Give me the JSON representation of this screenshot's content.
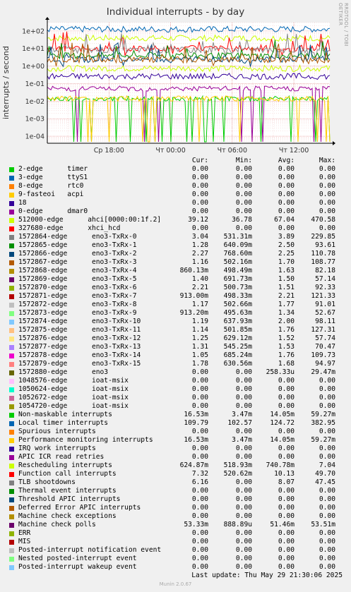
{
  "header": {
    "title": "Individual interrupts - by day",
    "side_credit": "RRDTOOL / TOBI OETIKER"
  },
  "chart_data": {
    "type": "line",
    "title": "Individual interrupts - by day",
    "ylabel": "interrupts / second",
    "yscale": "log",
    "ylim": [
      4e-05,
      300
    ],
    "y_ticks": [
      {
        "v": 100,
        "label": "1e+02"
      },
      {
        "v": 10,
        "label": "1e+01"
      },
      {
        "v": 1,
        "label": "1e+00"
      },
      {
        "v": 0.1,
        "label": "1e-01"
      },
      {
        "v": 0.01,
        "label": "1e-02"
      },
      {
        "v": 0.001,
        "label": "1e-03"
      },
      {
        "v": 0.0001,
        "label": "1e-04"
      }
    ],
    "x_range_hours": [
      12,
      39.5
    ],
    "x_ticks": [
      {
        "h": 18,
        "label": "Ср 18:00"
      },
      {
        "h": 24,
        "label": "Чт 00:00"
      },
      {
        "h": 30,
        "label": "Чт 06:00"
      },
      {
        "h": 36,
        "label": "Чт 12:00"
      },
      {
        "h": 42,
        "label": "Чт 18:00"
      }
    ],
    "grid": true,
    "series": [
      {
        "name": "512000-edge ahci[0000:00:1f.2]",
        "color": "#ccff00",
        "level": 39.12
      },
      {
        "name": "Local timer interrupts",
        "color": "#0066b3",
        "level": 124.72
      },
      {
        "name": "Rescheduling interrupts",
        "color": "#ccff00",
        "level": 0.74
      },
      {
        "name": "Function call interrupts",
        "color": "#ff0000",
        "level": 10.13
      },
      {
        "name": "TLB shootdowns",
        "color": "#8a8a8a",
        "level": 8.07
      },
      {
        "name": "1572864-edge eno3-TxRx-0",
        "color": "#008f00",
        "level": 3.89
      },
      {
        "name": "1572865-edge eno3-TxRx-1",
        "color": "#00487d",
        "level": 2.5
      },
      {
        "name": "1572866-edge eno3-TxRx-2",
        "color": "#b35a00",
        "level": 2.25
      },
      {
        "name": "1572880-edge eno3",
        "color": "#330099",
        "level": 0.258
      },
      {
        "name": "Machine check polls",
        "color": "#990099",
        "level": 0.0515
      },
      {
        "name": "Non-maskable interrupts",
        "color": "#00cc00",
        "level": 0.014
      },
      {
        "name": "Performance monitoring interrupts",
        "color": "#ffcc00",
        "level": 0.014
      }
    ]
  },
  "legend": {
    "headers": [
      "Cur:",
      "Min:",
      "Avg:",
      "Max:"
    ],
    "rows": [
      {
        "color": "#00cc00",
        "label": "2-edge      timer",
        "cur": "0.00",
        "min": "0.00",
        "avg": "0.00",
        "max": "0.00"
      },
      {
        "color": "#0066b3",
        "label": "3-edge      ttyS1",
        "cur": "0.00",
        "min": "0.00",
        "avg": "0.00",
        "max": "0.00"
      },
      {
        "color": "#ff8000",
        "label": "8-edge      rtc0",
        "cur": "0.00",
        "min": "0.00",
        "avg": "0.00",
        "max": "0.00"
      },
      {
        "color": "#ffcc00",
        "label": "9-fasteoi   acpi",
        "cur": "0.00",
        "min": "0.00",
        "avg": "0.00",
        "max": "0.00"
      },
      {
        "color": "#330099",
        "label": "18",
        "cur": "0.00",
        "min": "0.00",
        "avg": "0.00",
        "max": "0.00"
      },
      {
        "color": "#990099",
        "label": "0-edge      dmar0",
        "cur": "0.00",
        "min": "0.00",
        "avg": "0.00",
        "max": "0.00"
      },
      {
        "color": "#ccff00",
        "label": "512000-edge      ahci[0000:00:1f.2]",
        "cur": "39.12",
        "min": "36.78",
        "avg": "67.04",
        "max": "470.58"
      },
      {
        "color": "#ff0000",
        "label": "327680-edge      xhci_hcd",
        "cur": "0.00",
        "min": "0.00",
        "avg": "0.00",
        "max": "0.00"
      },
      {
        "color": "#808080",
        "label": "1572864-edge      eno3-TxRx-0",
        "cur": "3.04",
        "min": "531.31m",
        "avg": "3.89",
        "max": "229.85"
      },
      {
        "color": "#008f00",
        "label": "1572865-edge      eno3-TxRx-1",
        "cur": "1.28",
        "min": "640.09m",
        "avg": "2.50",
        "max": "93.61"
      },
      {
        "color": "#00487d",
        "label": "1572866-edge      eno3-TxRx-2",
        "cur": "2.27",
        "min": "768.60m",
        "avg": "2.25",
        "max": "110.78"
      },
      {
        "color": "#b35a00",
        "label": "1572867-edge      eno3-TxRx-3",
        "cur": "1.16",
        "min": "502.16m",
        "avg": "1.70",
        "max": "108.77"
      },
      {
        "color": "#b38f00",
        "label": "1572868-edge      eno3-TxRx-4",
        "cur": "860.13m",
        "min": "498.49m",
        "avg": "1.63",
        "max": "82.18"
      },
      {
        "color": "#6b006b",
        "label": "1572869-edge      eno3-TxRx-5",
        "cur": "1.40",
        "min": "691.73m",
        "avg": "1.50",
        "max": "57.14"
      },
      {
        "color": "#8fb300",
        "label": "1572870-edge      eno3-TxRx-6",
        "cur": "2.21",
        "min": "500.73m",
        "avg": "1.51",
        "max": "92.33"
      },
      {
        "color": "#b30000",
        "label": "1572871-edge      eno3-TxRx-7",
        "cur": "913.00m",
        "min": "498.33m",
        "avg": "2.21",
        "max": "121.33"
      },
      {
        "color": "#bebebe",
        "label": "1572872-edge      eno3-TxRx-8",
        "cur": "1.17",
        "min": "502.66m",
        "avg": "1.77",
        "max": "91.01"
      },
      {
        "color": "#80ff80",
        "label": "1572873-edge      eno3-TxRx-9",
        "cur": "913.20m",
        "min": "495.63m",
        "avg": "1.34",
        "max": "52.67"
      },
      {
        "color": "#80c9ff",
        "label": "1572874-edge      eno3-TxRx-10",
        "cur": "1.19",
        "min": "637.93m",
        "avg": "2.00",
        "max": "98.11"
      },
      {
        "color": "#ffc080",
        "label": "1572875-edge      eno3-TxRx-11",
        "cur": "1.14",
        "min": "501.85m",
        "avg": "1.76",
        "max": "127.31"
      },
      {
        "color": "#ffe680",
        "label": "1572876-edge      eno3-TxRx-12",
        "cur": "1.25",
        "min": "629.12m",
        "avg": "1.52",
        "max": "57.74"
      },
      {
        "color": "#aa80ff",
        "label": "1572877-edge      eno3-TxRx-13",
        "cur": "1.31",
        "min": "545.25m",
        "avg": "1.53",
        "max": "70.47"
      },
      {
        "color": "#ee00cc",
        "label": "1572878-edge      eno3-TxRx-14",
        "cur": "1.05",
        "min": "685.24m",
        "avg": "1.76",
        "max": "109.73"
      },
      {
        "color": "#ff8080",
        "label": "1572879-edge      eno3-TxRx-15",
        "cur": "1.78",
        "min": "630.56m",
        "avg": "1.68",
        "max": "94.97"
      },
      {
        "color": "#666600",
        "label": "1572880-edge      eno3",
        "cur": "0.00",
        "min": "0.00",
        "avg": "258.33u",
        "max": "29.47m"
      },
      {
        "color": "#ffbfff",
        "label": "1048576-edge      ioat-msix",
        "cur": "0.00",
        "min": "0.00",
        "avg": "0.00",
        "max": "0.00"
      },
      {
        "color": "#00ffcc",
        "label": "1050624-edge      ioat-msix",
        "cur": "0.00",
        "min": "0.00",
        "avg": "0.00",
        "max": "0.00"
      },
      {
        "color": "#cc6699",
        "label": "1052672-edge      ioat-msix",
        "cur": "0.00",
        "min": "0.00",
        "avg": "0.00",
        "max": "0.00"
      },
      {
        "color": "#999900",
        "label": "1054720-edge      ioat-msix",
        "cur": "0.00",
        "min": "0.00",
        "avg": "0.00",
        "max": "0.00"
      },
      {
        "color": "#00cc00",
        "label": "Non-maskable interrupts",
        "cur": "16.53m",
        "min": "3.47m",
        "avg": "14.05m",
        "max": "59.27m"
      },
      {
        "color": "#0066b3",
        "label": "Local timer interrupts",
        "cur": "109.79",
        "min": "102.57",
        "avg": "124.72",
        "max": "382.95"
      },
      {
        "color": "#ff8000",
        "label": "Spurious interrupts",
        "cur": "0.00",
        "min": "0.00",
        "avg": "0.00",
        "max": "0.00"
      },
      {
        "color": "#ffcc00",
        "label": "Performance monitoring interrupts",
        "cur": "16.53m",
        "min": "3.47m",
        "avg": "14.05m",
        "max": "59.27m"
      },
      {
        "color": "#330099",
        "label": "IRQ work interrupts",
        "cur": "0.00",
        "min": "0.00",
        "avg": "0.00",
        "max": "0.00"
      },
      {
        "color": "#990099",
        "label": "APIC ICR read retries",
        "cur": "0.00",
        "min": "0.00",
        "avg": "0.00",
        "max": "0.00"
      },
      {
        "color": "#ccff00",
        "label": "Rescheduling interrupts",
        "cur": "624.87m",
        "min": "518.93m",
        "avg": "740.78m",
        "max": "7.04"
      },
      {
        "color": "#ff0000",
        "label": "Function call interrupts",
        "cur": "7.32",
        "min": "520.62m",
        "avg": "10.13",
        "max": "49.70"
      },
      {
        "color": "#808080",
        "label": "TLB shootdowns",
        "cur": "6.16",
        "min": "0.00",
        "avg": "8.07",
        "max": "47.45"
      },
      {
        "color": "#008f00",
        "label": "Thermal event interrupts",
        "cur": "0.00",
        "min": "0.00",
        "avg": "0.00",
        "max": "0.00"
      },
      {
        "color": "#00487d",
        "label": "Threshold APIC interrupts",
        "cur": "0.00",
        "min": "0.00",
        "avg": "0.00",
        "max": "0.00"
      },
      {
        "color": "#b35a00",
        "label": "Deferred Error APIC interrupts",
        "cur": "0.00",
        "min": "0.00",
        "avg": "0.00",
        "max": "0.00"
      },
      {
        "color": "#b38f00",
        "label": "Machine check exceptions",
        "cur": "0.00",
        "min": "0.00",
        "avg": "0.00",
        "max": "0.00"
      },
      {
        "color": "#6b006b",
        "label": "Machine check polls",
        "cur": "53.33m",
        "min": "888.89u",
        "avg": "51.46m",
        "max": "53.51m"
      },
      {
        "color": "#8fb300",
        "label": "ERR",
        "cur": "0.00",
        "min": "0.00",
        "avg": "0.00",
        "max": "0.00"
      },
      {
        "color": "#b30000",
        "label": "MIS",
        "cur": "0.00",
        "min": "0.00",
        "avg": "0.00",
        "max": "0.00"
      },
      {
        "color": "#bebebe",
        "label": "Posted-interrupt notification event",
        "cur": "0.00",
        "min": "0.00",
        "avg": "0.00",
        "max": "0.00"
      },
      {
        "color": "#80ff80",
        "label": "Nested posted-interrupt event",
        "cur": "0.00",
        "min": "0.00",
        "avg": "0.00",
        "max": "0.00"
      },
      {
        "color": "#80c9ff",
        "label": "Posted-interrupt wakeup event",
        "cur": "0.00",
        "min": "0.00",
        "avg": "0.00",
        "max": "0.00"
      }
    ]
  },
  "footer": {
    "last_update": "Last update: Thu May 29 21:30:06 2025",
    "munin_version": "Munin 2.0.67"
  }
}
